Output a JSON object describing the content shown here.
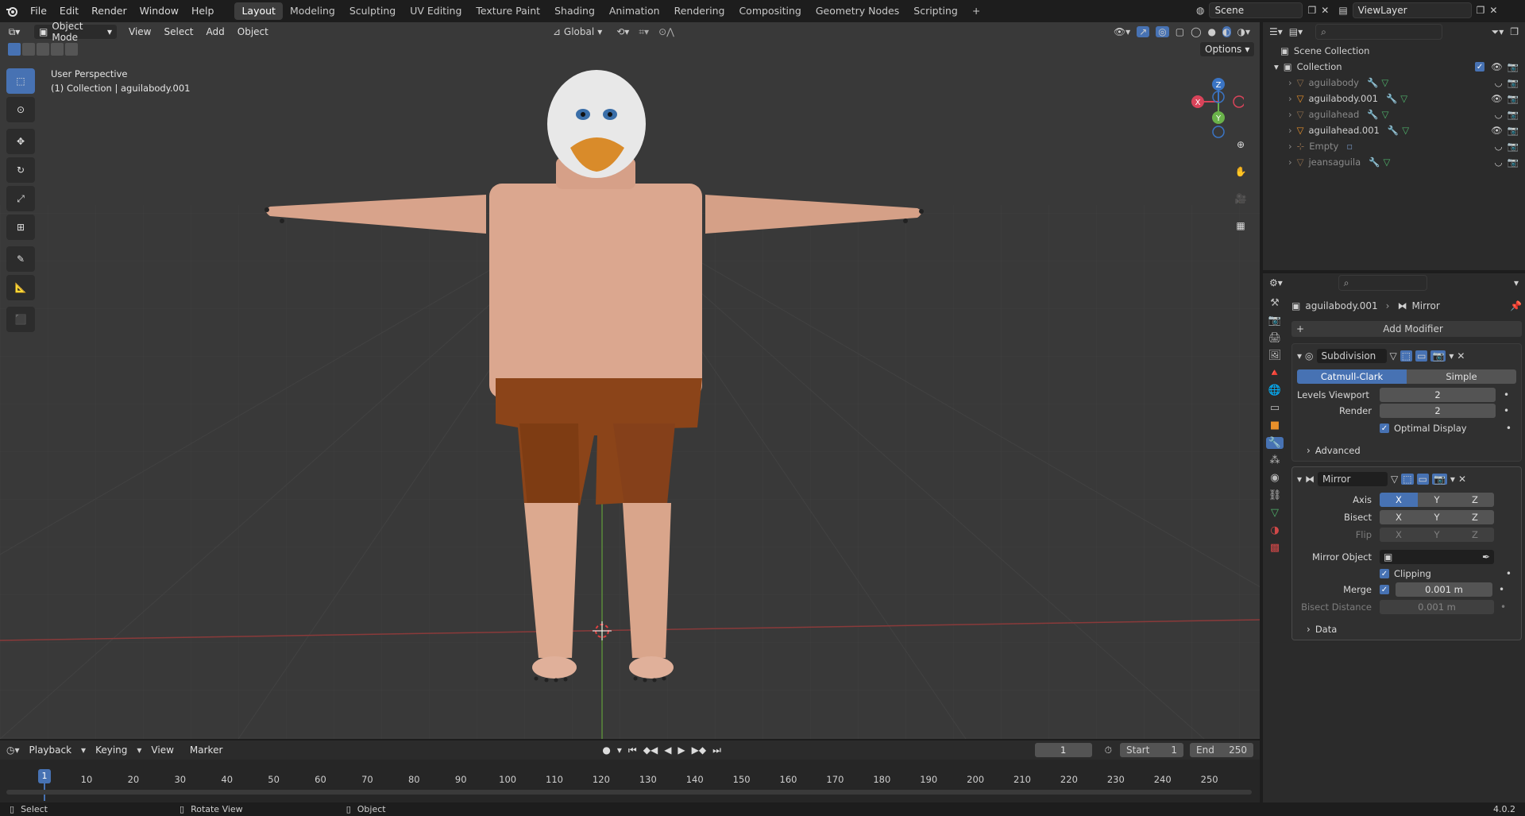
{
  "menubar": {
    "items": [
      "File",
      "Edit",
      "Render",
      "Window",
      "Help"
    ],
    "workspaces": [
      "Layout",
      "Modeling",
      "Sculpting",
      "UV Editing",
      "Texture Paint",
      "Shading",
      "Animation",
      "Rendering",
      "Compositing",
      "Geometry Nodes",
      "Scripting"
    ],
    "active_workspace": "Layout",
    "add_tab": "+",
    "scene": "Scene",
    "view_layer": "ViewLayer"
  },
  "viewport": {
    "mode": "Object Mode",
    "menus": [
      "View",
      "Select",
      "Add",
      "Object"
    ],
    "transform_orientation": "Global",
    "options_label": "Options",
    "perspective": "User Perspective",
    "collection_info": "(1) Collection | aguilabody.001",
    "gizmo": {
      "z": "Z",
      "y": "Y",
      "x": "X"
    }
  },
  "outliner": {
    "title": "Scene Collection",
    "collection": "Collection",
    "objects": [
      {
        "name": "aguilabody",
        "dim": true
      },
      {
        "name": "aguilabody.001",
        "dim": false
      },
      {
        "name": "aguilahead",
        "dim": true
      },
      {
        "name": "aguilahead.001",
        "dim": false
      },
      {
        "name": "Empty",
        "dim": true
      },
      {
        "name": "jeansaguila",
        "dim": true
      }
    ]
  },
  "properties": {
    "breadcrumb_object": "aguilabody.001",
    "breadcrumb_modifier": "Mirror",
    "add_modifier": "Add Modifier",
    "subdivision": {
      "name": "Subdivision",
      "type_options": [
        "Catmull-Clark",
        "Simple"
      ],
      "selected_type": "Catmull-Clark",
      "levels_viewport_label": "Levels Viewport",
      "levels_viewport": "2",
      "render_label": "Render",
      "render": "2",
      "optimal_display": "Optimal Display",
      "advanced": "Advanced"
    },
    "mirror": {
      "name": "Mirror",
      "axis_label": "Axis",
      "bisect_label": "Bisect",
      "flip_label": "Flip",
      "axes": [
        "X",
        "Y",
        "Z"
      ],
      "mirror_object_label": "Mirror Object",
      "clipping": "Clipping",
      "merge_label": "Merge",
      "merge_value": "0.001 m",
      "bisect_distance_label": "Bisect Distance",
      "bisect_distance_value": "0.001 m",
      "data": "Data"
    }
  },
  "timeline": {
    "menus": [
      "Playback",
      "Keying",
      "View",
      "Marker"
    ],
    "current_frame": "1",
    "start_label": "Start",
    "start": "1",
    "end_label": "End",
    "end": "250",
    "ticks": [
      "1",
      "10",
      "20",
      "30",
      "40",
      "50",
      "60",
      "70",
      "80",
      "90",
      "100",
      "110",
      "120",
      "130",
      "140",
      "150",
      "160",
      "170",
      "180",
      "190",
      "200",
      "210",
      "220",
      "230",
      "240",
      "250"
    ]
  },
  "statusbar": {
    "select": "Select",
    "rotate": "Rotate View",
    "object": "Object",
    "version": "4.0.2"
  },
  "colors": {
    "accent": "#4772b3",
    "viewport_bg": "#393939",
    "panel_bg": "#2b2b2b",
    "skin": "#d9a48c",
    "shorts": "#8b4419",
    "beak": "#d98b2a"
  }
}
